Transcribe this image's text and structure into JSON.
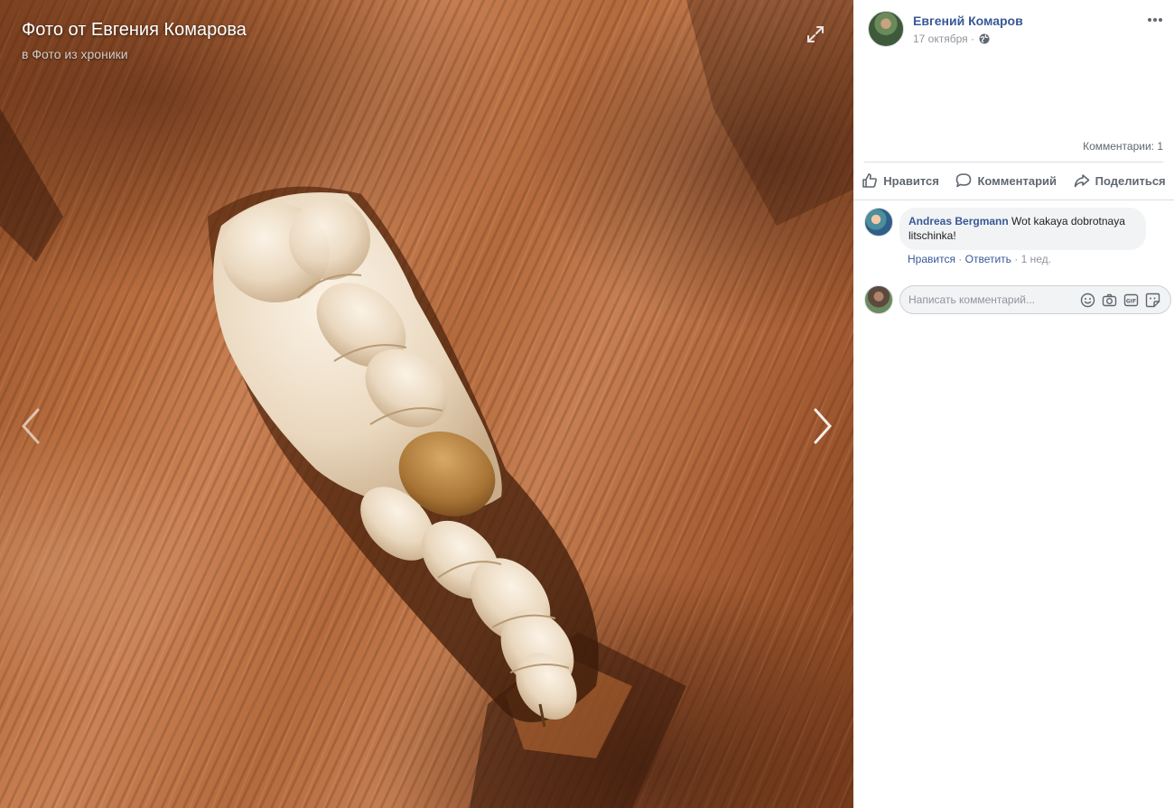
{
  "viewer": {
    "title": "Фото от Евгения Комарова",
    "subtitle": "в Фото из хроники",
    "icons": {
      "expand": "expand-icon",
      "prev": "chevron-left-icon",
      "next": "chevron-right-icon"
    }
  },
  "post": {
    "author": "Евгений Комаров",
    "date": "17 октября ·",
    "privacy_icon": "globe-icon",
    "more_icon": "more-icon",
    "comments_count": "Комментарии: 1"
  },
  "actions": {
    "like": "Нравится",
    "comment": "Комментарий",
    "share": "Поделиться"
  },
  "comments": [
    {
      "author": "Andreas Bergmann",
      "text": " Wot kakaya dobrotnaya litschinka!",
      "like": "Нравится",
      "separator": " · ",
      "reply": "Ответить",
      "time": " · 1 нед."
    }
  ],
  "composer": {
    "placeholder": "Написать комментарий..."
  },
  "colors": {
    "link": "#385898",
    "muted": "#90949c",
    "bubble": "#f2f3f5"
  }
}
